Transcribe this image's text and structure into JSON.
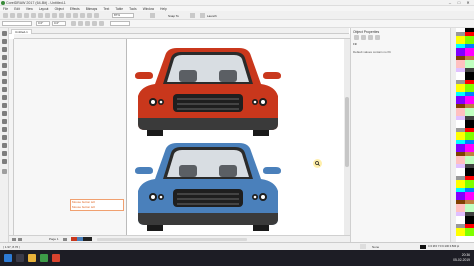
{
  "window": {
    "title": "CorelDRAW 2017 (64-Bit) - Untitled-1",
    "min_label": "–",
    "max_label": "□",
    "close_label": "✕"
  },
  "menu": [
    "File",
    "Edit",
    "View",
    "Layout",
    "Object",
    "Effects",
    "Bitmaps",
    "Text",
    "Table",
    "Tools",
    "Window",
    "Help"
  ],
  "toolbar": {
    "zoom": "87%",
    "snap": "Snap To",
    "launch": "Launch"
  },
  "propertybar": {
    "width": "0.0\"",
    "height": "0.0\""
  },
  "document_tab": "Untitled-1",
  "docker": {
    "title": "Object Properties",
    "fill_label": "Fill",
    "message": "Default values contain no fill."
  },
  "page_nav": {
    "label": "Page 1"
  },
  "annotation": {
    "line1": "Mouse button left",
    "line2": "Mouse button left"
  },
  "status": {
    "coords": "( 1.97, 8.76 )",
    "fill": "None",
    "outline": "C:0 M:0 Y:0 K:100 0.500 pt"
  },
  "taskbar": {
    "time": "20:36",
    "date": "05-02-2019"
  },
  "colors": {
    "car_top": "#c9371c",
    "car_bottom": "#4a80bb"
  },
  "icons": {
    "start": "windows-start-icon",
    "pointer": "pick-tool-icon",
    "zoom": "zoom-cursor-icon"
  }
}
